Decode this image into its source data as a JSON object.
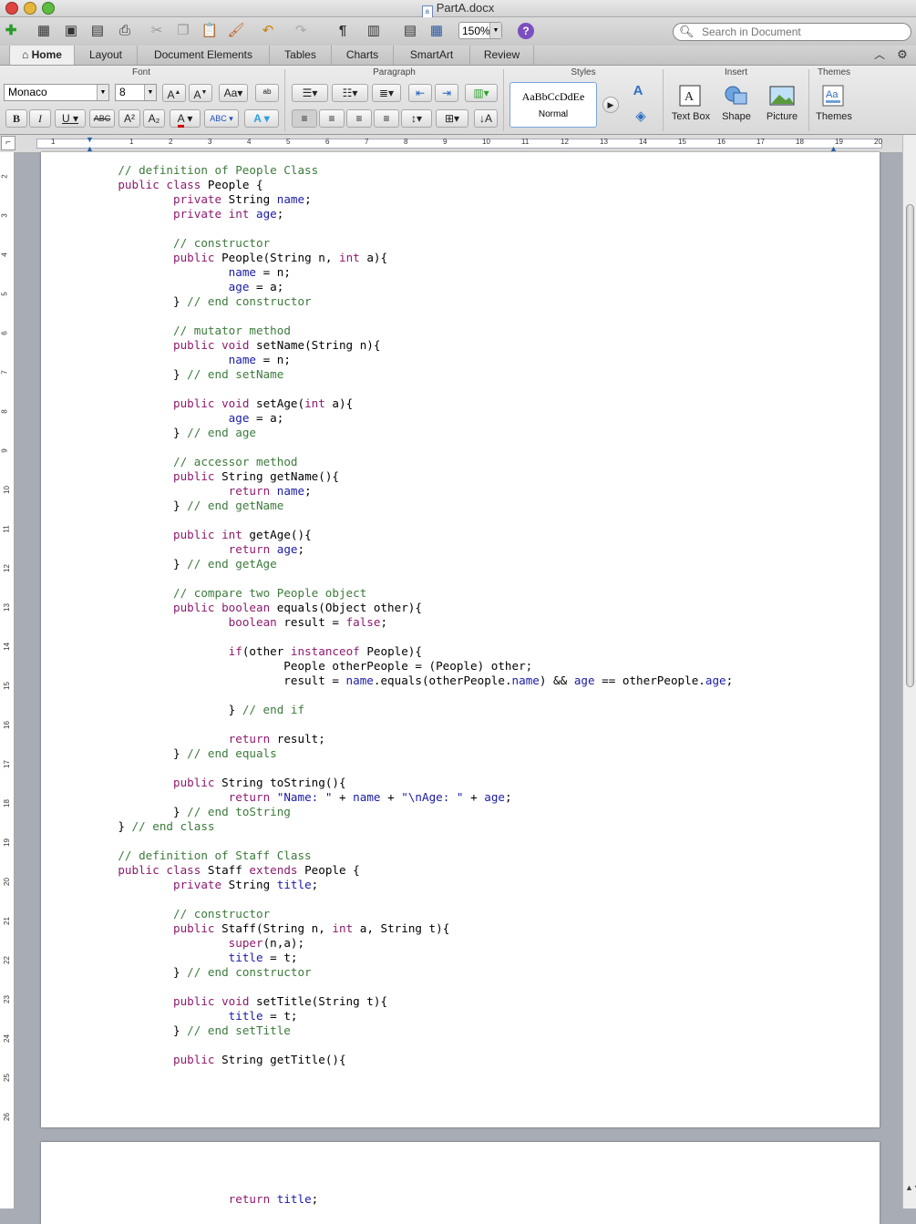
{
  "window": {
    "title": "PartA.docx"
  },
  "toolbar": {
    "zoom": "150%",
    "search_placeholder": "Search in Document"
  },
  "tabs": [
    {
      "label": "Home",
      "active": true
    },
    {
      "label": "Layout"
    },
    {
      "label": "Document Elements"
    },
    {
      "label": "Tables"
    },
    {
      "label": "Charts"
    },
    {
      "label": "SmartArt"
    },
    {
      "label": "Review"
    }
  ],
  "ribbon": {
    "groups": {
      "font": "Font",
      "paragraph": "Paragraph",
      "styles": "Styles",
      "insert": "Insert",
      "themes": "Themes"
    },
    "font_name": "Monaco",
    "font_size": "8",
    "style_preview": "AaBbCcDdEe",
    "style_name": "Normal",
    "insert": {
      "text_box": "Text Box",
      "shape": "Shape",
      "picture": "Picture"
    },
    "themes_label": "Themes"
  },
  "ruler": {
    "horizontal": [
      "1",
      "1",
      "2",
      "3",
      "4",
      "5",
      "6",
      "7",
      "8",
      "9",
      "10",
      "11",
      "12",
      "13",
      "14",
      "15",
      "16",
      "17",
      "18",
      "19",
      "20"
    ],
    "vertical": [
      "2",
      "3",
      "4",
      "5",
      "6",
      "7",
      "8",
      "9",
      "10",
      "11",
      "12",
      "13",
      "14",
      "15",
      "16",
      "17",
      "18",
      "19",
      "20",
      "21",
      "22",
      "23",
      "24",
      "25",
      "26"
    ]
  },
  "colors": {
    "keyword": "#8e1a6e",
    "field": "#1a1aa6",
    "comment": "#3c7a3c"
  },
  "document": {
    "page1_lines": [
      [
        {
          "t": "    // definition of People Class",
          "c": "cmt"
        }
      ],
      [
        {
          "t": "    "
        },
        {
          "t": "public class",
          "c": "kw"
        },
        {
          "t": " People {"
        }
      ],
      [
        {
          "t": "            "
        },
        {
          "t": "private",
          "c": "kw"
        },
        {
          "t": " String "
        },
        {
          "t": "name",
          "c": "fld"
        },
        {
          "t": ";"
        }
      ],
      [
        {
          "t": "            "
        },
        {
          "t": "private int",
          "c": "kw"
        },
        {
          "t": " "
        },
        {
          "t": "age",
          "c": "fld"
        },
        {
          "t": ";"
        }
      ],
      [
        {
          "t": ""
        }
      ],
      [
        {
          "t": "            "
        },
        {
          "t": "// constructor",
          "c": "cmt"
        }
      ],
      [
        {
          "t": "            "
        },
        {
          "t": "public",
          "c": "kw"
        },
        {
          "t": " People(String n, "
        },
        {
          "t": "int",
          "c": "kw"
        },
        {
          "t": " a){"
        }
      ],
      [
        {
          "t": "                    "
        },
        {
          "t": "name",
          "c": "fld"
        },
        {
          "t": " = n;"
        }
      ],
      [
        {
          "t": "                    "
        },
        {
          "t": "age",
          "c": "fld"
        },
        {
          "t": " = a;"
        }
      ],
      [
        {
          "t": "            } "
        },
        {
          "t": "// end constructor",
          "c": "cmt"
        }
      ],
      [
        {
          "t": ""
        }
      ],
      [
        {
          "t": "            "
        },
        {
          "t": "// mutator method",
          "c": "cmt"
        }
      ],
      [
        {
          "t": "            "
        },
        {
          "t": "public void",
          "c": "kw"
        },
        {
          "t": " setName(String n){"
        }
      ],
      [
        {
          "t": "                    "
        },
        {
          "t": "name",
          "c": "fld"
        },
        {
          "t": " = n;"
        }
      ],
      [
        {
          "t": "            } "
        },
        {
          "t": "// end setName",
          "c": "cmt"
        }
      ],
      [
        {
          "t": ""
        }
      ],
      [
        {
          "t": "            "
        },
        {
          "t": "public void",
          "c": "kw"
        },
        {
          "t": " setAge("
        },
        {
          "t": "int",
          "c": "kw"
        },
        {
          "t": " a){"
        }
      ],
      [
        {
          "t": "                    "
        },
        {
          "t": "age",
          "c": "fld"
        },
        {
          "t": " = a;"
        }
      ],
      [
        {
          "t": "            } "
        },
        {
          "t": "// end age",
          "c": "cmt"
        }
      ],
      [
        {
          "t": ""
        }
      ],
      [
        {
          "t": "            "
        },
        {
          "t": "// accessor method",
          "c": "cmt"
        }
      ],
      [
        {
          "t": "            "
        },
        {
          "t": "public",
          "c": "kw"
        },
        {
          "t": " String getName(){"
        }
      ],
      [
        {
          "t": "                    "
        },
        {
          "t": "return",
          "c": "kw"
        },
        {
          "t": " "
        },
        {
          "t": "name",
          "c": "fld"
        },
        {
          "t": ";"
        }
      ],
      [
        {
          "t": "            } "
        },
        {
          "t": "// end getName",
          "c": "cmt"
        }
      ],
      [
        {
          "t": ""
        }
      ],
      [
        {
          "t": "            "
        },
        {
          "t": "public int",
          "c": "kw"
        },
        {
          "t": " getAge(){"
        }
      ],
      [
        {
          "t": "                    "
        },
        {
          "t": "return",
          "c": "kw"
        },
        {
          "t": " "
        },
        {
          "t": "age",
          "c": "fld"
        },
        {
          "t": ";"
        }
      ],
      [
        {
          "t": "            } "
        },
        {
          "t": "// end getAge",
          "c": "cmt"
        }
      ],
      [
        {
          "t": ""
        }
      ],
      [
        {
          "t": "            "
        },
        {
          "t": "// compare two People object",
          "c": "cmt"
        }
      ],
      [
        {
          "t": "            "
        },
        {
          "t": "public boolean",
          "c": "kw"
        },
        {
          "t": " equals(Object other){"
        }
      ],
      [
        {
          "t": "                    "
        },
        {
          "t": "boolean",
          "c": "kw"
        },
        {
          "t": " result = "
        },
        {
          "t": "false",
          "c": "kw"
        },
        {
          "t": ";"
        }
      ],
      [
        {
          "t": ""
        }
      ],
      [
        {
          "t": "                    "
        },
        {
          "t": "if",
          "c": "kw"
        },
        {
          "t": "(other "
        },
        {
          "t": "instanceof",
          "c": "kw"
        },
        {
          "t": " People){"
        }
      ],
      [
        {
          "t": "                            People otherPeople = (People) other;"
        }
      ],
      [
        {
          "t": "                            result = "
        },
        {
          "t": "name",
          "c": "fld"
        },
        {
          "t": ".equals(otherPeople."
        },
        {
          "t": "name",
          "c": "fld"
        },
        {
          "t": ") && "
        },
        {
          "t": "age",
          "c": "fld"
        },
        {
          "t": " == otherPeople."
        },
        {
          "t": "age",
          "c": "fld"
        },
        {
          "t": ";"
        }
      ],
      [
        {
          "t": ""
        }
      ],
      [
        {
          "t": "                    } "
        },
        {
          "t": "// end if",
          "c": "cmt"
        }
      ],
      [
        {
          "t": ""
        }
      ],
      [
        {
          "t": "                    "
        },
        {
          "t": "return",
          "c": "kw"
        },
        {
          "t": " result;"
        }
      ],
      [
        {
          "t": "            } "
        },
        {
          "t": "// end equals",
          "c": "cmt"
        }
      ],
      [
        {
          "t": ""
        }
      ],
      [
        {
          "t": "            "
        },
        {
          "t": "public",
          "c": "kw"
        },
        {
          "t": " String toString(){"
        }
      ],
      [
        {
          "t": "                    "
        },
        {
          "t": "return",
          "c": "kw"
        },
        {
          "t": " "
        },
        {
          "t": "\"Name: \"",
          "c": "str"
        },
        {
          "t": " + "
        },
        {
          "t": "name",
          "c": "fld"
        },
        {
          "t": " + "
        },
        {
          "t": "\"\\nAge: \"",
          "c": "str"
        },
        {
          "t": " + "
        },
        {
          "t": "age",
          "c": "fld"
        },
        {
          "t": ";"
        }
      ],
      [
        {
          "t": "            } "
        },
        {
          "t": "// end toString",
          "c": "cmt"
        }
      ],
      [
        {
          "t": "    } "
        },
        {
          "t": "// end class",
          "c": "cmt"
        }
      ],
      [
        {
          "t": ""
        }
      ],
      [
        {
          "t": "    // definition of Staff Class",
          "c": "cmt"
        }
      ],
      [
        {
          "t": "    "
        },
        {
          "t": "public class",
          "c": "kw"
        },
        {
          "t": " Staff "
        },
        {
          "t": "extends",
          "c": "kw"
        },
        {
          "t": " People {"
        }
      ],
      [
        {
          "t": "            "
        },
        {
          "t": "private",
          "c": "kw"
        },
        {
          "t": " String "
        },
        {
          "t": "title",
          "c": "fld"
        },
        {
          "t": ";"
        }
      ],
      [
        {
          "t": ""
        }
      ],
      [
        {
          "t": "            "
        },
        {
          "t": "// constructor",
          "c": "cmt"
        }
      ],
      [
        {
          "t": "            "
        },
        {
          "t": "public",
          "c": "kw"
        },
        {
          "t": " Staff(String n, "
        },
        {
          "t": "int",
          "c": "kw"
        },
        {
          "t": " a, String t){"
        }
      ],
      [
        {
          "t": "                    "
        },
        {
          "t": "super",
          "c": "kw"
        },
        {
          "t": "(n,a);"
        }
      ],
      [
        {
          "t": "                    "
        },
        {
          "t": "title",
          "c": "fld"
        },
        {
          "t": " = t;"
        }
      ],
      [
        {
          "t": "            } "
        },
        {
          "t": "// end constructor",
          "c": "cmt"
        }
      ],
      [
        {
          "t": ""
        }
      ],
      [
        {
          "t": "            "
        },
        {
          "t": "public void",
          "c": "kw"
        },
        {
          "t": " setTitle(String t){"
        }
      ],
      [
        {
          "t": "                    "
        },
        {
          "t": "title",
          "c": "fld"
        },
        {
          "t": " = t;"
        }
      ],
      [
        {
          "t": "            } "
        },
        {
          "t": "// end setTitle",
          "c": "cmt"
        }
      ],
      [
        {
          "t": ""
        }
      ],
      [
        {
          "t": "            "
        },
        {
          "t": "public",
          "c": "kw"
        },
        {
          "t": " String getTitle(){"
        }
      ]
    ],
    "page2_lines": [
      [
        {
          "t": "                    "
        },
        {
          "t": "return",
          "c": "kw"
        },
        {
          "t": " "
        },
        {
          "t": "title",
          "c": "fld"
        },
        {
          "t": ";"
        }
      ]
    ]
  }
}
